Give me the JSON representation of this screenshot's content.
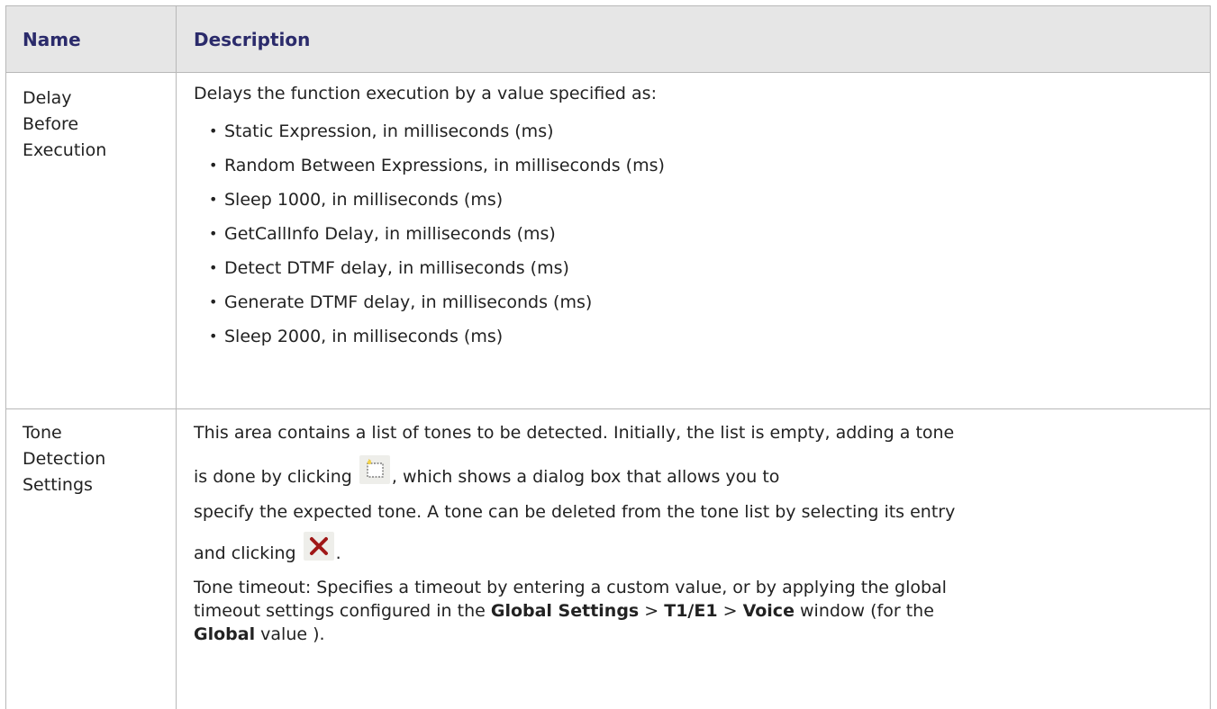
{
  "header": {
    "name": "Name",
    "description": "Description"
  },
  "rows": [
    {
      "name_lines": [
        "Delay",
        "Before",
        "Execution"
      ],
      "intro": "Delays the function execution by a value specified as:",
      "bullets": [
        "Static Expression, in milliseconds (ms)",
        "Random Between Expressions, in milliseconds (ms)",
        "Sleep 1000, in milliseconds (ms)",
        "GetCallInfo Delay, in milliseconds (ms)",
        "Detect DTMF delay, in milliseconds (ms)",
        "Generate DTMF delay, in milliseconds (ms)",
        "Sleep 2000, in milliseconds (ms)"
      ]
    },
    {
      "name_lines": [
        "Tone",
        "Detection",
        "Settings"
      ],
      "p1_line1": "This area contains a list of tones to be detected. Initially, the list is empty, adding a tone",
      "p1_line2_pre": "is done by clicking ",
      "p1_line2_post": ", which shows a dialog box that allows you to",
      "p2_line1": "specify the expected tone. A tone can be deleted from the tone list by selecting its entry",
      "p2_line2_pre": "and clicking ",
      "p2_line2_post": ".",
      "timeout": {
        "t1": "Tone timeout: Specifies a timeout by entering a custom value, or by applying the global",
        "t2": "timeout settings configured in the ",
        "b1": "Global Settings",
        "sep1": " > ",
        "b2": "T1/E1",
        "sep2": " > ",
        "b3": "Voice",
        "t3": " window (for the",
        "b4": "Global",
        "t4": " value )."
      }
    }
  ],
  "icons": {
    "new": "new-item-icon",
    "delete": "delete-x-icon"
  },
  "colors": {
    "header_bg": "#e6e6e6",
    "header_text": "#2b2b6b",
    "border": "#b8b8b8",
    "delete_icon": "#a01818"
  }
}
